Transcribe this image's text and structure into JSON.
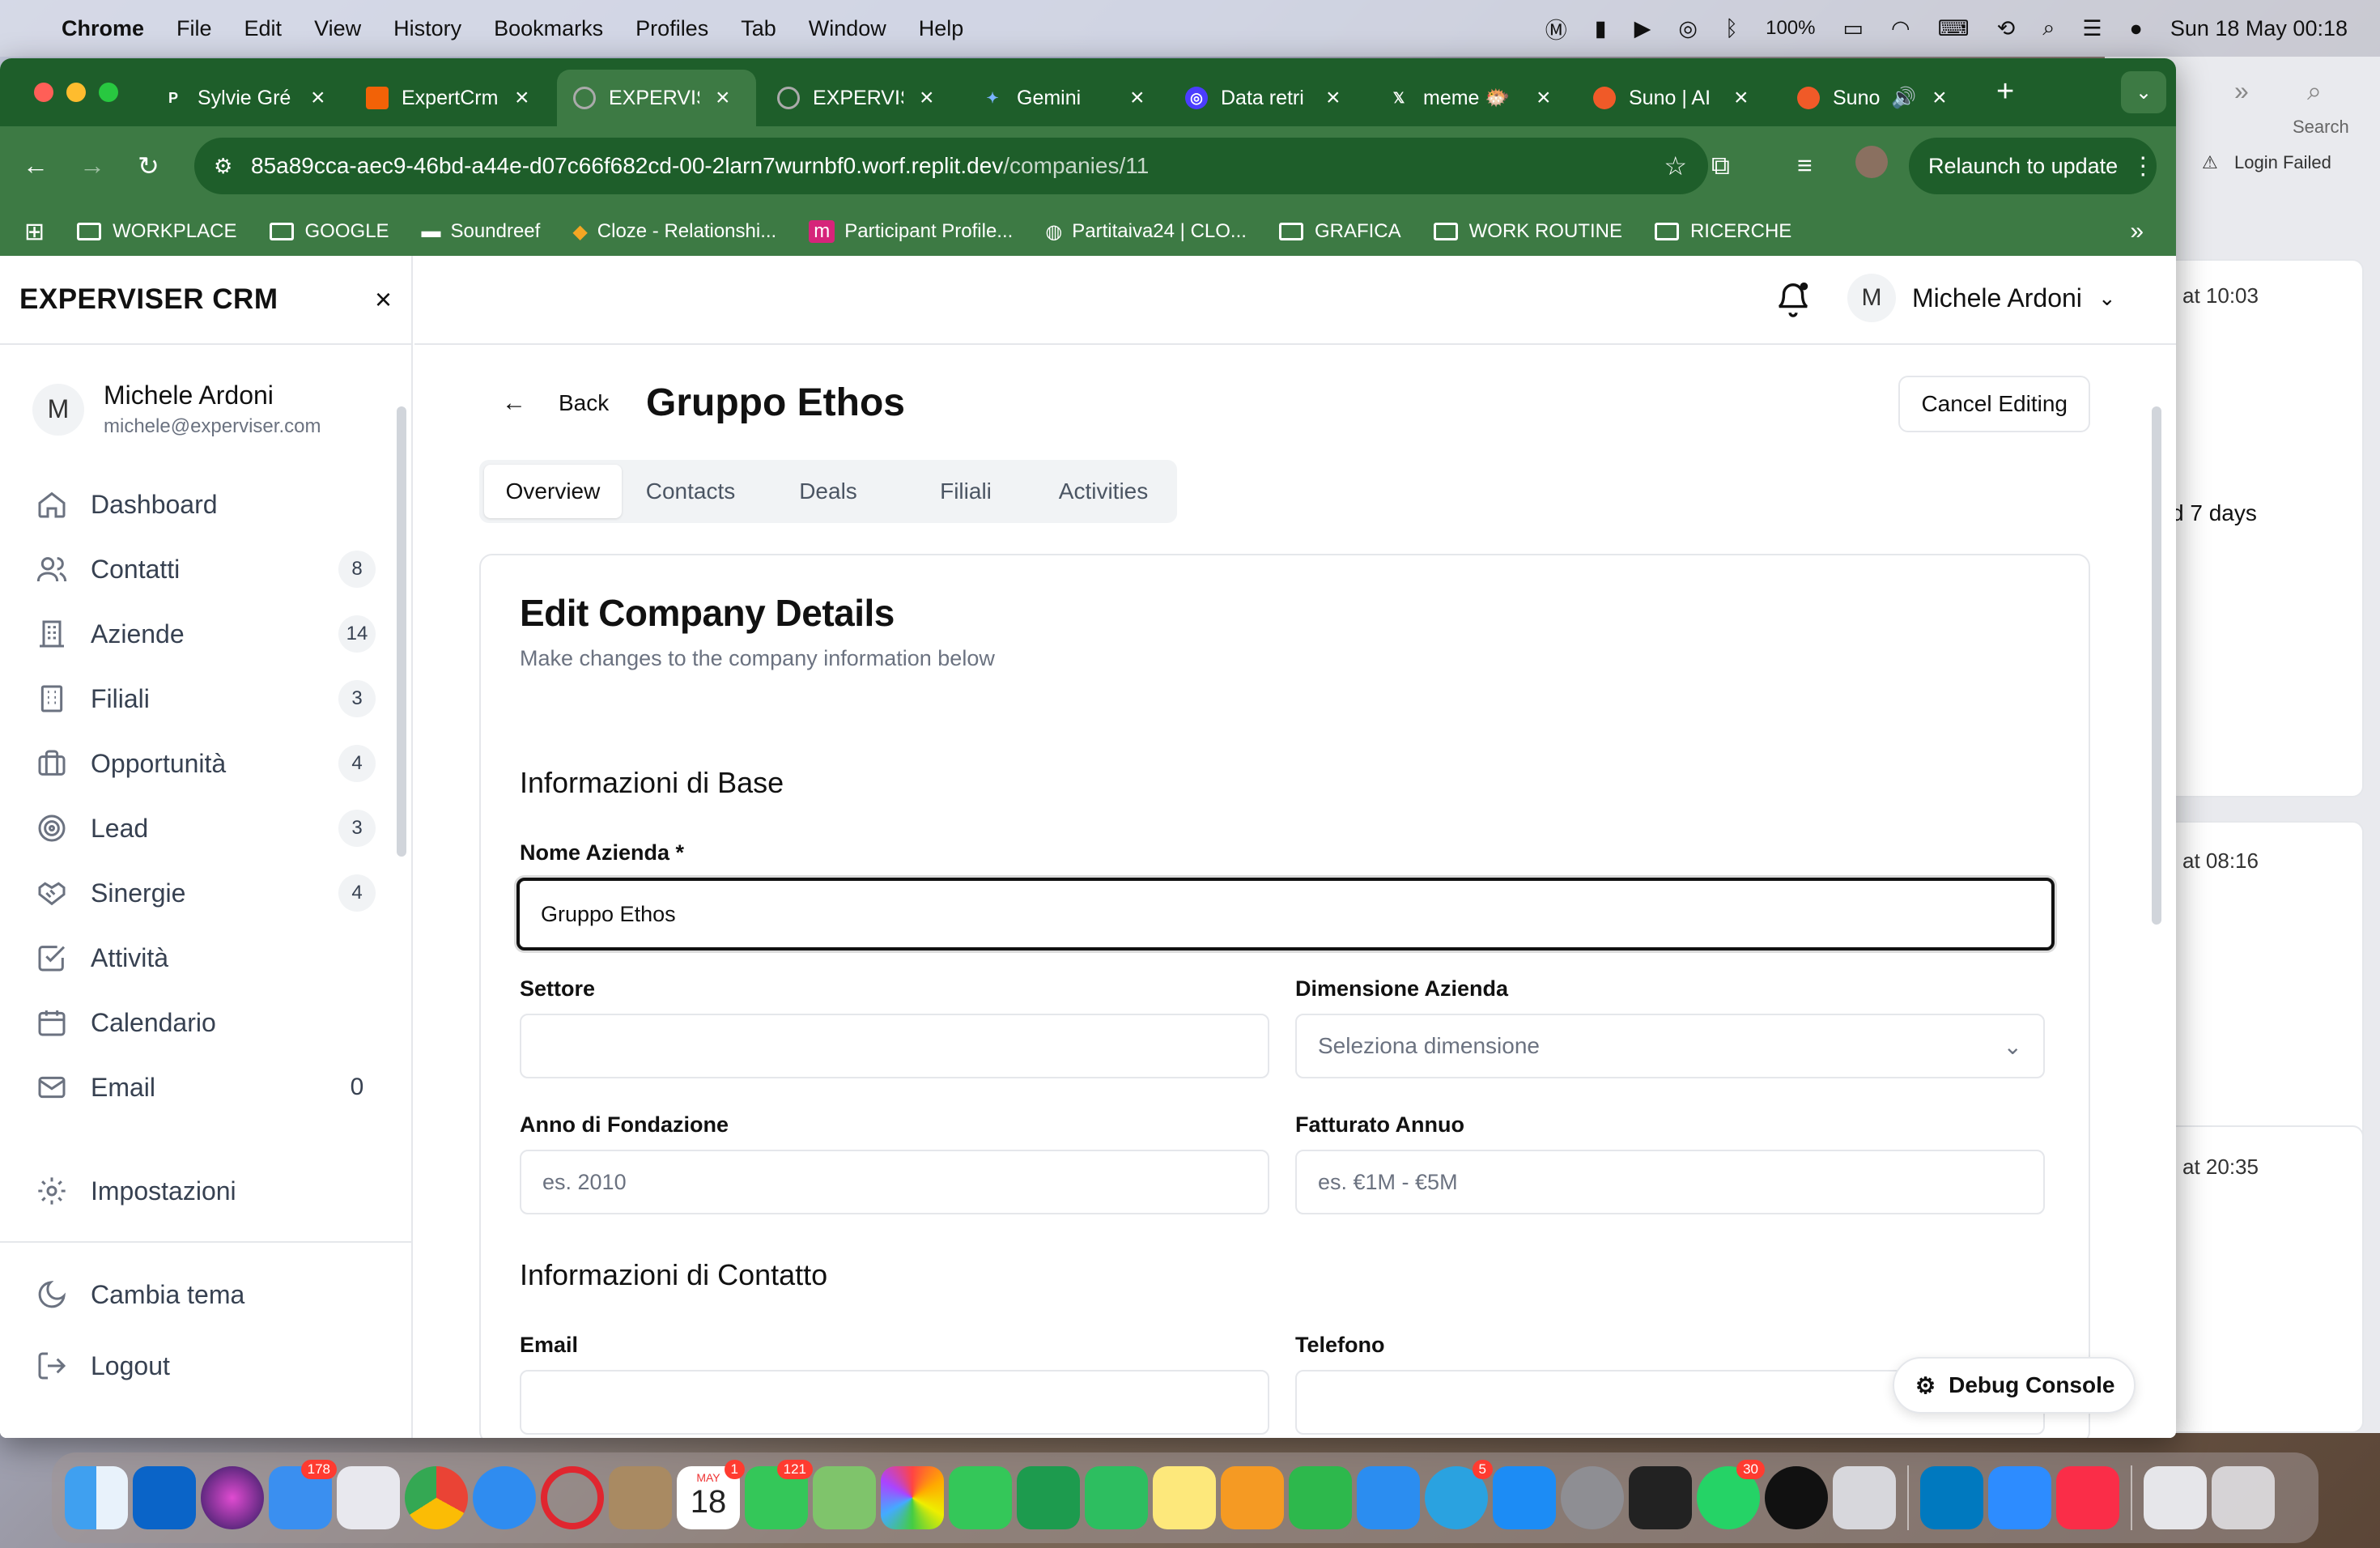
{
  "menubar": {
    "app": "Chrome",
    "items": [
      "File",
      "Edit",
      "View",
      "History",
      "Bookmarks",
      "Profiles",
      "Tab",
      "Window",
      "Help"
    ],
    "battery": "100%",
    "datetime": "Sun 18 May  00:18"
  },
  "background_window": {
    "search_label": "Search",
    "login_failed": "Login Failed",
    "times": [
      "at 10:03",
      "d 7 days",
      "at 08:16",
      "at 20:35"
    ]
  },
  "browser": {
    "tabs": [
      {
        "title": "Sylvie Gré",
        "icon": "P"
      },
      {
        "title": "ExpertCrm",
        "icon": "replit"
      },
      {
        "title": "EXPERVIS",
        "icon": "globe",
        "active": true
      },
      {
        "title": "EXPERVIS",
        "icon": "globe"
      },
      {
        "title": "Gemini",
        "icon": "gemini"
      },
      {
        "title": "Data retri",
        "icon": "openai"
      },
      {
        "title": "meme 🐡",
        "icon": "x"
      },
      {
        "title": "Suno | AI",
        "icon": "suno"
      },
      {
        "title": "Suno",
        "icon": "suno"
      }
    ],
    "url_host": "85a89cca-aec9-46bd-a44e-d07c66f682cd-00-2larn7wurnbf0.worf.replit.dev",
    "url_path": "/companies/11",
    "relaunch": "Relaunch to update",
    "bookmarks": [
      "WORKPLACE",
      "GOOGLE",
      "Soundreef",
      "Cloze - Relationshi...",
      "Participant Profile...",
      "Partitaiva24 | CLO...",
      "GRAFICA",
      "WORK ROUTINE",
      "RICERCHE"
    ]
  },
  "sidebar": {
    "brand": "EXPERVISER CRM",
    "user": {
      "initial": "M",
      "name": "Michele Ardoni",
      "email": "michele@experviser.com"
    },
    "items": [
      {
        "label": "Dashboard",
        "icon": "home-icon",
        "count": ""
      },
      {
        "label": "Contatti",
        "icon": "users-icon",
        "count": "8"
      },
      {
        "label": "Aziende",
        "icon": "building-icon",
        "count": "14"
      },
      {
        "label": "Filiali",
        "icon": "office-icon",
        "count": "3"
      },
      {
        "label": "Opportunità",
        "icon": "briefcase-icon",
        "count": "4"
      },
      {
        "label": "Lead",
        "icon": "target-icon",
        "count": "3"
      },
      {
        "label": "Sinergie",
        "icon": "handshake-icon",
        "count": "4"
      },
      {
        "label": "Attività",
        "icon": "check-square-icon",
        "count": ""
      },
      {
        "label": "Calendario",
        "icon": "calendar-icon",
        "count": ""
      },
      {
        "label": "Email",
        "icon": "mail-icon",
        "count": "0"
      }
    ],
    "settings": "Impostazioni",
    "theme": "Cambia tema",
    "logout": "Logout"
  },
  "topbar": {
    "user_initial": "M",
    "user_name": "Michele Ardoni"
  },
  "page": {
    "back": "Back",
    "title": "Gruppo Ethos",
    "cancel": "Cancel Editing",
    "tabs": [
      "Overview",
      "Contacts",
      "Deals",
      "Filiali",
      "Activities"
    ],
    "form": {
      "title": "Edit Company Details",
      "subtitle": "Make changes to the company information below",
      "section_base": "Informazioni di Base",
      "section_contact": "Informazioni di Contatto",
      "nome_label": "Nome Azienda *",
      "nome_value": "Gruppo Ethos",
      "settore_label": "Settore",
      "settore_value": "",
      "dimensione_label": "Dimensione Azienda",
      "dimensione_placeholder": "Seleziona dimensione",
      "anno_label": "Anno di Fondazione",
      "anno_placeholder": "es. 2010",
      "fatturato_label": "Fatturato Annuo",
      "fatturato_placeholder": "es. €1M - €5M",
      "email_label": "Email",
      "telefono_label": "Telefono"
    }
  },
  "debug_console": "Debug Console",
  "dock_badges": {
    "mail": "178",
    "calendar": "1",
    "messages": "121",
    "telegram": "5",
    "whatsapp": "30"
  },
  "calendar_day": "18",
  "calendar_month": "MAY"
}
